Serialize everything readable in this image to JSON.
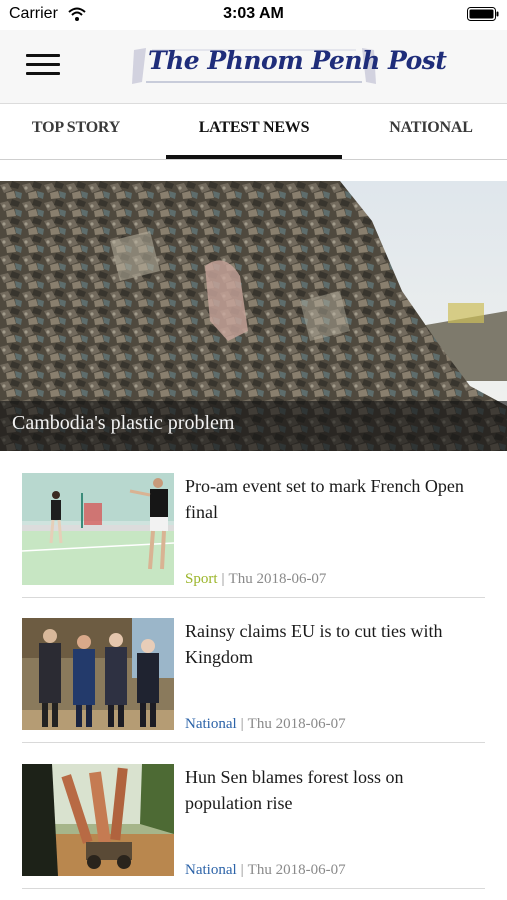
{
  "status_bar": {
    "carrier": "Carrier",
    "time": "3:03 AM"
  },
  "header": {
    "logo_text": "The Phnom Penh Post",
    "menu_icon": "hamburger-menu-icon"
  },
  "tabs": [
    {
      "label": "TOP STORY",
      "active": false
    },
    {
      "label": "LATEST NEWS",
      "active": true
    },
    {
      "label": "NATIONAL",
      "active": false
    }
  ],
  "hero": {
    "caption": "Cambodia's plastic problem"
  },
  "articles": [
    {
      "headline": "Pro-am event set to mark French Open final",
      "category": "Sport",
      "category_color": "#9bb52a",
      "separator": "|",
      "date": "Thu 2018-06-07"
    },
    {
      "headline": "Rainsy claims EU is to cut ties with Kingdom",
      "category": "National",
      "category_color": "#2c63a8",
      "separator": "|",
      "date": "Thu 2018-06-07"
    },
    {
      "headline": "Hun Sen blames forest loss on population rise",
      "category": "National",
      "category_color": "#2c63a8",
      "separator": "|",
      "date": "Thu 2018-06-07"
    }
  ],
  "colors": {
    "header_bg": "#f7f7f7",
    "logo_blue": "#1f2d7a",
    "sport": "#9bb52a",
    "national": "#2c63a8"
  }
}
